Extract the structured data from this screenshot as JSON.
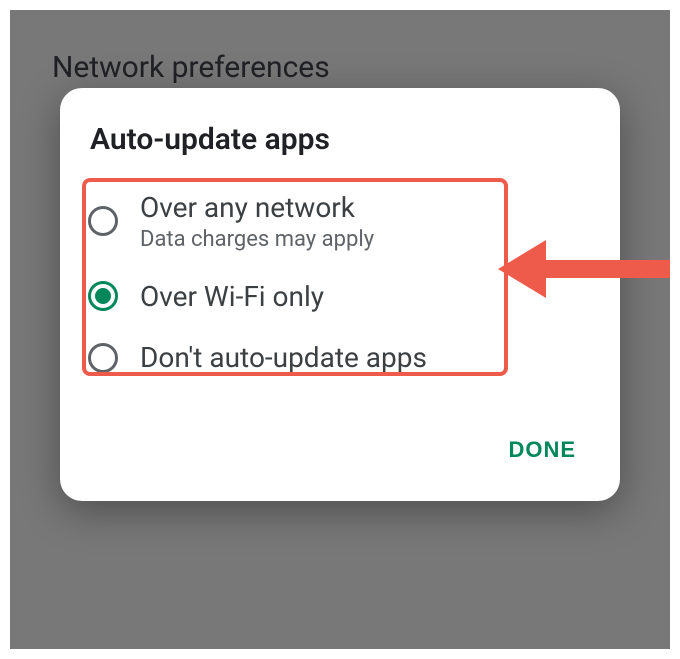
{
  "background": {
    "title": "Network preferences"
  },
  "dialog": {
    "title": "Auto-update apps",
    "options": [
      {
        "label": "Over any network",
        "sub": "Data charges may apply",
        "selected": false
      },
      {
        "label": "Over Wi-Fi only",
        "sub": "",
        "selected": true
      },
      {
        "label": "Don't auto-update apps",
        "sub": "",
        "selected": false
      }
    ],
    "done_label": "DONE"
  },
  "annotation": {
    "highlight_color": "#ee5b4a",
    "arrow_color": "#ee5b4a"
  }
}
